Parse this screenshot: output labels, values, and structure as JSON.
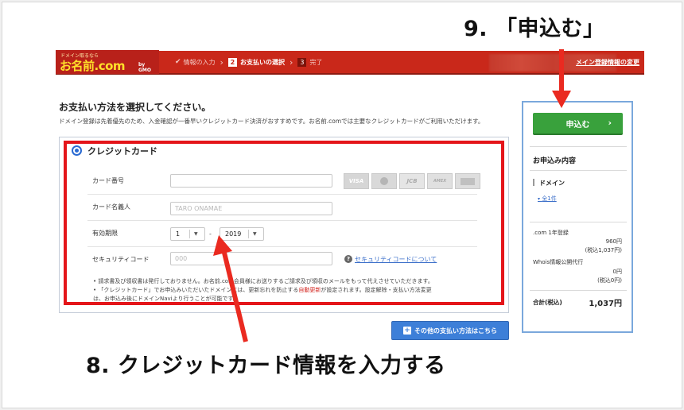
{
  "callouts": {
    "step9": "9. 「申込む」",
    "step8": "8. クレジットカード情報を入力する"
  },
  "header": {
    "logo_tagline": "ドメイン取るなら",
    "logo_main": "お名前.com",
    "logo_gmo": "by GMO",
    "steps": [
      {
        "num": "✔",
        "label": "情報の入力"
      },
      {
        "num": "2",
        "label": "お支払いの選択"
      },
      {
        "num": "3",
        "label": "完了"
      }
    ],
    "domain_link": "メイン登録情報の変更"
  },
  "main": {
    "title": "お支払い方法を選択してください。",
    "description": "ドメイン登録は先着優先のため、入金確認が一番早いクレジットカード決済がおすすめです。お名前.comでは主要なクレジットカードがご利用いただけます。",
    "payment_option_label": "クレジットカード",
    "form": {
      "card_number_label": "カード番号",
      "card_holder_label": "カード名義人",
      "card_holder_placeholder": "TARO ONAMAE",
      "expiry_label": "有効期限",
      "expiry_month": "1",
      "expiry_year": "2019",
      "expiry_separator": "-",
      "security_label": "セキュリティコード",
      "security_placeholder": "000",
      "security_help": "セキュリティコードについて"
    },
    "card_brands": [
      "VISA",
      "MasterCard",
      "JCB",
      "AMERICAN EXPRESS",
      "Diners"
    ],
    "notes": {
      "line1": "• 請求書及び領収書は発行しておりません。お名前.com会員様にお送りするご請求及び領収のメールをもって代えさせていただきます。",
      "line2_pre": "• 「クレジットカード」でお申込みいただいたドメインには、更新忘れを防止する",
      "line2_link": "自動更新",
      "line2_post": "が設定されます。設定解除・支払い方法変更",
      "line3": "は、お申込み後にドメインNaviより行うことが可能です。"
    },
    "other_methods_button": "その他の支払い方法はこちら"
  },
  "sidebar": {
    "apply_button": "申込む",
    "summary_title": "お申込み内容",
    "domain_label": "ドメイン",
    "count_link": "全1件",
    "items": [
      {
        "name": ".com 1年登録",
        "price": "960円",
        "tax": "(税込1,037円)"
      },
      {
        "name": "Whois情報公開代行",
        "price": "0円",
        "tax": "(税込0円)"
      }
    ],
    "total_label": "合計(税込)",
    "total_value": "1,037円"
  },
  "colors": {
    "header_red": "#c9281a",
    "highlight_red": "#e4151a",
    "apply_green": "#39a13c",
    "link_blue": "#3a6ec9",
    "sidebar_border": "#7aa8dc"
  }
}
